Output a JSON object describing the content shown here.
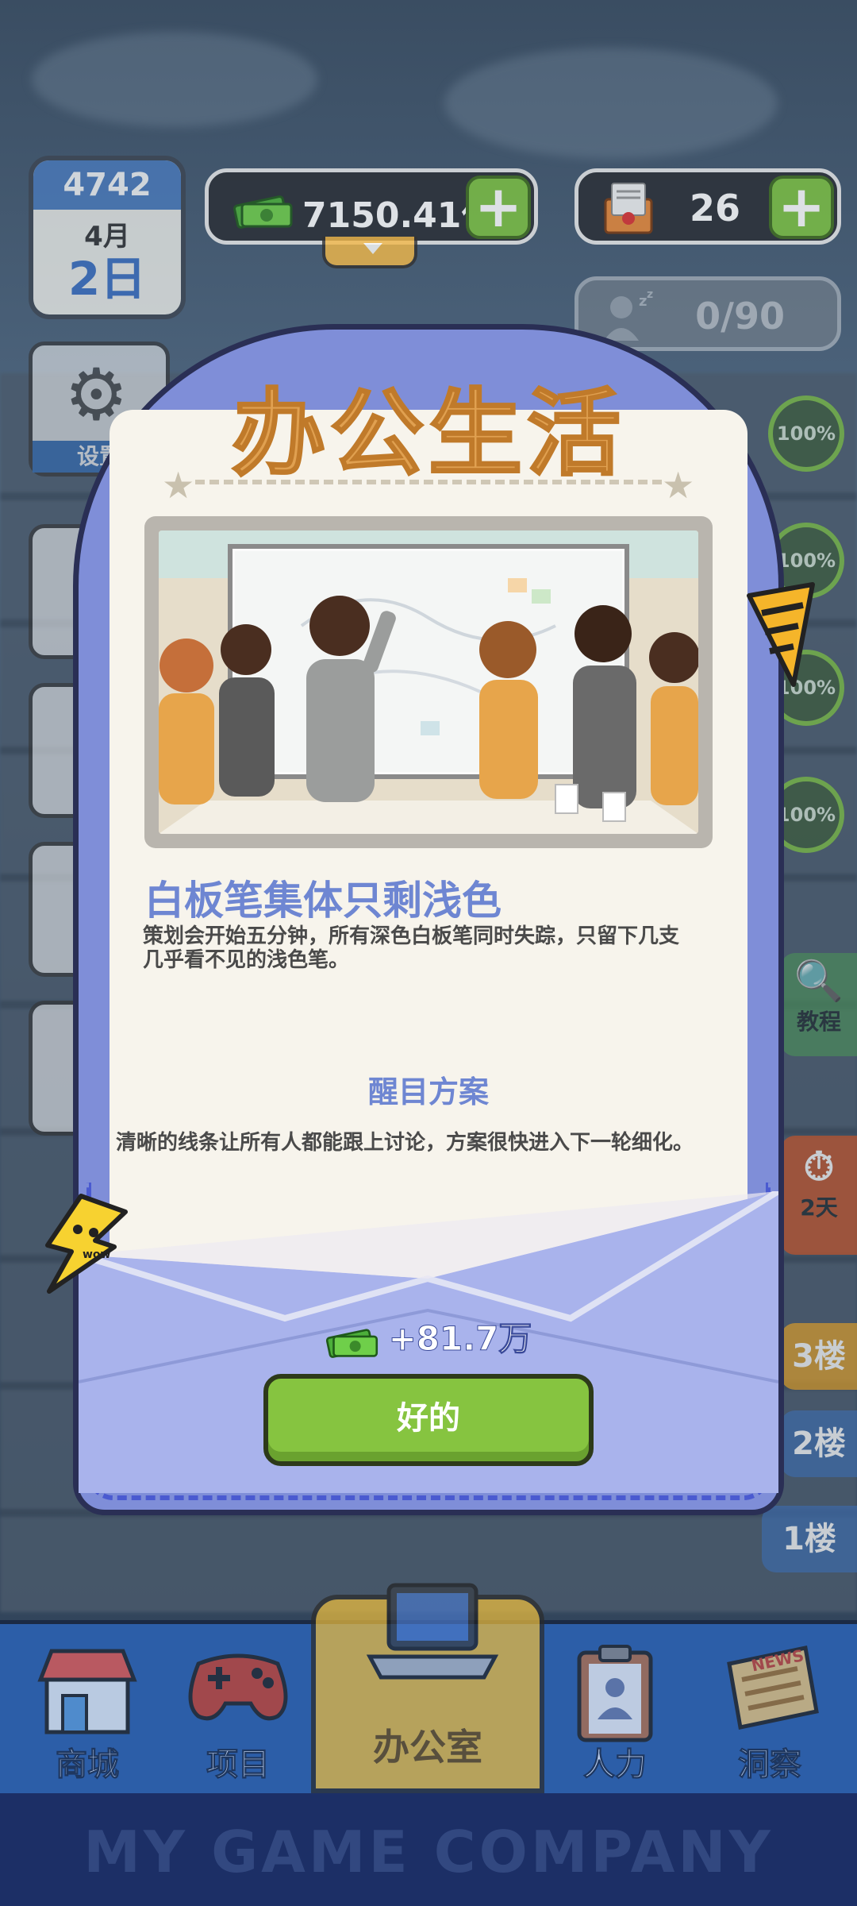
{
  "hud": {
    "calendar": {
      "year": "4742",
      "month": "4月",
      "day": "2日"
    },
    "money": {
      "value": "7150.41亿",
      "add_label": "+"
    },
    "mail": {
      "value": "26",
      "add_label": "+"
    },
    "idle_staff": {
      "value": "0/90"
    }
  },
  "left_side": {
    "settings_label": "设置"
  },
  "right_side": {
    "badges": [
      "100%",
      "100%",
      "100%",
      "100%"
    ],
    "tutorial_label": "教程",
    "countdown_label": "2天",
    "floors": [
      "3楼",
      "2楼",
      "1楼"
    ]
  },
  "modal": {
    "title": "办公生活",
    "event_title": "白板笔集体只剩浅色",
    "event_desc": "策划会开始五分钟，所有深色白板笔同时失踪，只留下几支几乎看不见的浅色笔。",
    "plan_title": "醒目方案",
    "plan_desc": "清晰的线条让所有人都能跟上讨论，方案很快进入下一轮细化。",
    "reward": "+81.7万",
    "ok_label": "好的",
    "mascot_text": "wow"
  },
  "nav": {
    "items": [
      {
        "label": "商城",
        "icon": "shop-icon"
      },
      {
        "label": "项目",
        "icon": "gamepad-icon"
      },
      {
        "label": "办公室",
        "icon": "laptop-icon"
      },
      {
        "label": "人力",
        "icon": "clipboard-icon"
      },
      {
        "label": "洞察",
        "icon": "news-icon"
      }
    ],
    "news_badge": "NEWS"
  },
  "footer": {
    "brand": "MY GAME COMPANY"
  },
  "colors": {
    "accent_blue": "#6e86d2",
    "title_orange": "#e0a050",
    "button_green": "#86c440"
  }
}
